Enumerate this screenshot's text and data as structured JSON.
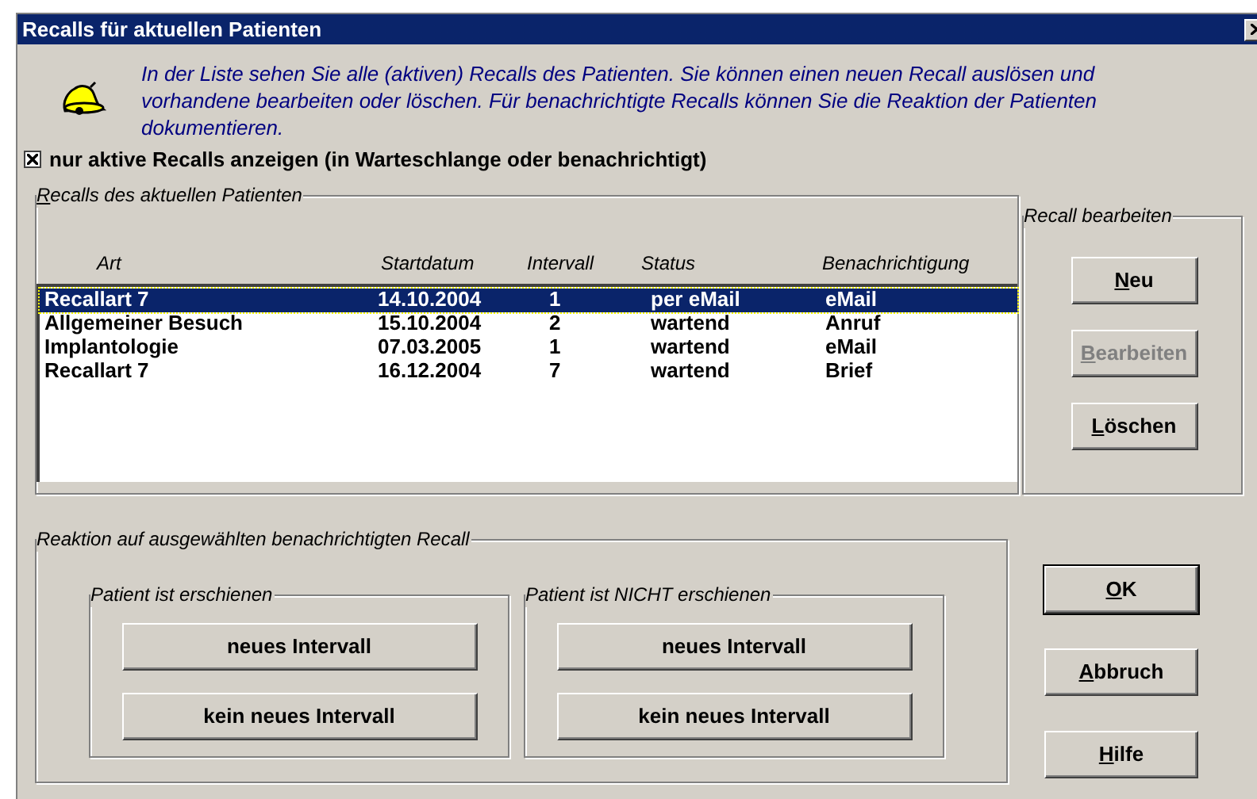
{
  "window": {
    "title": "Recalls für aktuellen Patienten"
  },
  "info_text": "In der Liste sehen Sie alle (aktiven) Recalls des Patienten. Sie können einen neuen Recall auslösen und vorhandene bearbeiten oder löschen. Für benachrichtigte Recalls können Sie die Reaktion der Patienten dokumentieren.",
  "filter_checkbox": {
    "label": "nur aktive Recalls anzeigen (in Warteschlange oder benachrichtigt)",
    "checked": true
  },
  "recalls_group": {
    "title": "Recalls des aktuellen Patienten",
    "mnemonic": true,
    "columns": [
      "Art",
      "Startdatum",
      "Intervall",
      "Status",
      "Benachrichtigung"
    ],
    "rows": [
      {
        "cells": [
          "Recallart 7",
          "14.10.2004",
          "1",
          "per eMail",
          "eMail"
        ],
        "selected": true
      },
      {
        "cells": [
          "Allgemeiner Besuch",
          "15.10.2004",
          "2",
          "wartend",
          "Anruf"
        ],
        "selected": false
      },
      {
        "cells": [
          "Implantologie",
          "07.03.2005",
          "1",
          "wartend",
          "eMail"
        ],
        "selected": false
      },
      {
        "cells": [
          "Recallart 7",
          "16.12.2004",
          "7",
          "wartend",
          "Brief"
        ],
        "selected": false
      }
    ]
  },
  "edit_group": {
    "title": "Recall bearbeiten",
    "buttons": [
      {
        "label": "Neu",
        "mnemonic": true,
        "disabled": false
      },
      {
        "label": "Bearbeiten",
        "mnemonic": true,
        "disabled": true
      },
      {
        "label": "Löschen",
        "mnemonic": true,
        "disabled": false
      }
    ]
  },
  "reaction_group": {
    "title": "Reaktion auf ausgewählten benachrichtigten Recall",
    "subgroups": [
      {
        "title": "Patient ist erschienen",
        "buttons": [
          "neues Intervall",
          "kein neues Intervall"
        ]
      },
      {
        "title": "Patient ist NICHT erschienen",
        "buttons": [
          "neues Intervall",
          "kein neues Intervall"
        ]
      }
    ]
  },
  "dialog_buttons": [
    {
      "label": "OK",
      "mnemonic": true,
      "default": true
    },
    {
      "label": "Abbruch",
      "mnemonic": true,
      "default": false
    },
    {
      "label": "Hilfe",
      "mnemonic": true,
      "default": false
    }
  ]
}
